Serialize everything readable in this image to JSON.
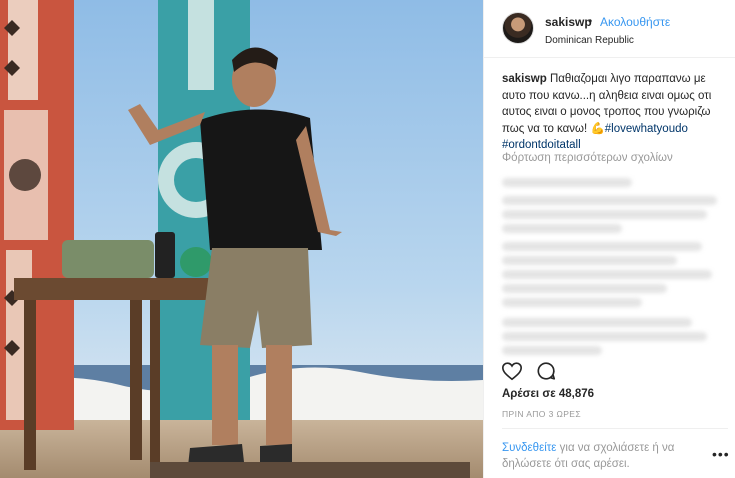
{
  "post": {
    "username": "sakiswp",
    "dot": "•",
    "follow_label": "Ακολουθήστε",
    "location": "Dominican Republic",
    "caption_user": "sakiswp",
    "caption_text": "Παθιαζομαι λιγο παραπανω με αυτο που κανω...η αληθεια ειναι ομως οτι αυτος ειναι ο μονος τροπος που γνωριζω πως να το κανω! ",
    "caption_emoji": "💪",
    "hashtags": [
      "#lovewhatyoudo",
      "#ordontdoitatall"
    ],
    "load_more_comments": "Φόρτωση περισσότερων σχολίων",
    "likes": "Αρέσει σε 48,876",
    "time_ago": "ΠΡΙΝ ΑΠΟ 3 ΩΡΕΣ",
    "login_link": "Συνδεθείτε",
    "login_text": " για να σχολιάσετε ή να δηλώσετε ότι σας αρέσει.",
    "more_options": "•••"
  },
  "icons": {
    "heart": "heart-icon",
    "comment": "comment-icon",
    "more": "more-options-icon"
  },
  "colors": {
    "link": "#3897f0",
    "text": "#262626",
    "muted": "#999999",
    "hashtag": "#003569"
  }
}
